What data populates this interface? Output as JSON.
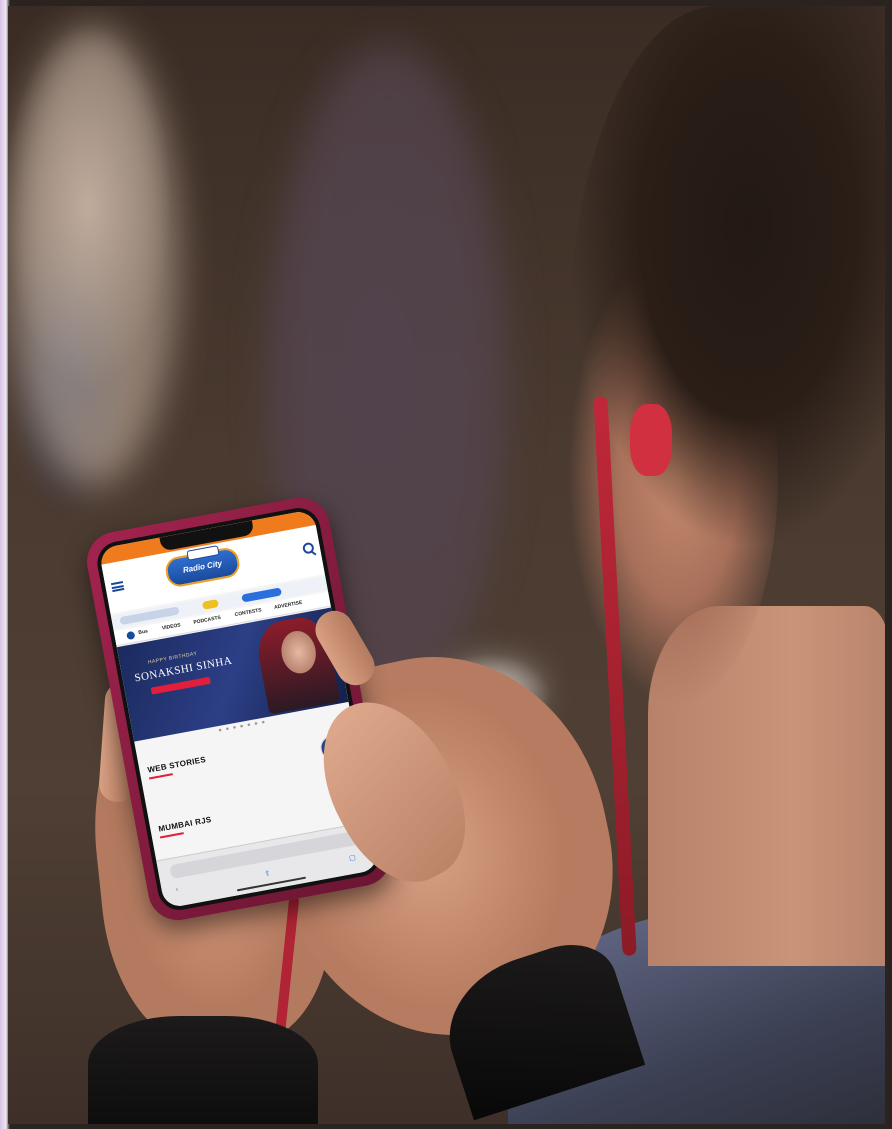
{
  "site": {
    "logo_badge": "",
    "logo_text": "Radio City",
    "frequency": "",
    "nav_items": [
      "Bus",
      "VIDEOS",
      "PODCASTS",
      "CONTESTS",
      "ADVERTISE"
    ]
  },
  "banner": {
    "kicker": "HAPPY BIRTHDAY",
    "title": "SONAKSHI SINHA",
    "subtitle": ""
  },
  "sections": {
    "web_stories": "WEB STORIES",
    "mumbai_rjs": "MUMBAI RJS"
  },
  "browser": {
    "url": ""
  },
  "colors": {
    "header_orange": "#ef7b1c",
    "brand_blue": "#1b4a9c",
    "accent_red": "#e01f3d",
    "phone_case": "#8c1e42"
  },
  "icons": [
    "menu-icon",
    "search-icon",
    "back-icon",
    "share-icon",
    "tabs-icon"
  ]
}
